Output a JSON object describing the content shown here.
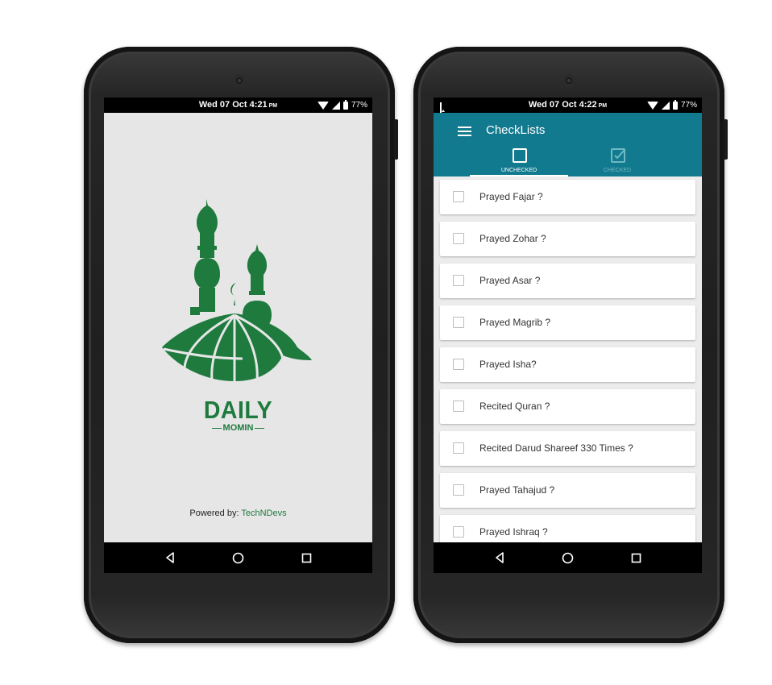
{
  "left_phone": {
    "status_time": "Wed 07 Oct 4:21",
    "status_ampm": "PM",
    "battery": "77%",
    "logo_word": "DAILY",
    "logo_sub": "MOMIN",
    "powered_prefix": "Powered by: ",
    "powered_brand": "TechNDevs"
  },
  "right_phone": {
    "status_time": "Wed 07 Oct 4:22",
    "status_ampm": "PM",
    "battery": "77%",
    "app_title": "CheckLists",
    "tabs": [
      {
        "label": "UNCHECKED",
        "icon": "checkbox-empty-icon",
        "active": true
      },
      {
        "label": "CHECKED",
        "icon": "checkbox-checked-icon",
        "active": false
      }
    ],
    "items": [
      {
        "label": "Prayed Fajar ?",
        "checked": false
      },
      {
        "label": "Prayed Zohar ?",
        "checked": false
      },
      {
        "label": "Prayed Asar ?",
        "checked": false
      },
      {
        "label": "Prayed Magrib ?",
        "checked": false
      },
      {
        "label": "Prayed Isha?",
        "checked": false
      },
      {
        "label": "Recited Quran ?",
        "checked": false
      },
      {
        "label": "Recited Darud Shareef 330 Times ?",
        "checked": false
      },
      {
        "label": "Prayed Tahajud ?",
        "checked": false
      },
      {
        "label": "Prayed Ishraq ?",
        "checked": false
      }
    ]
  },
  "colors": {
    "brand_green": "#1f7a3e",
    "appbar_teal": "#127a8e",
    "background": "#e6e6e6"
  }
}
